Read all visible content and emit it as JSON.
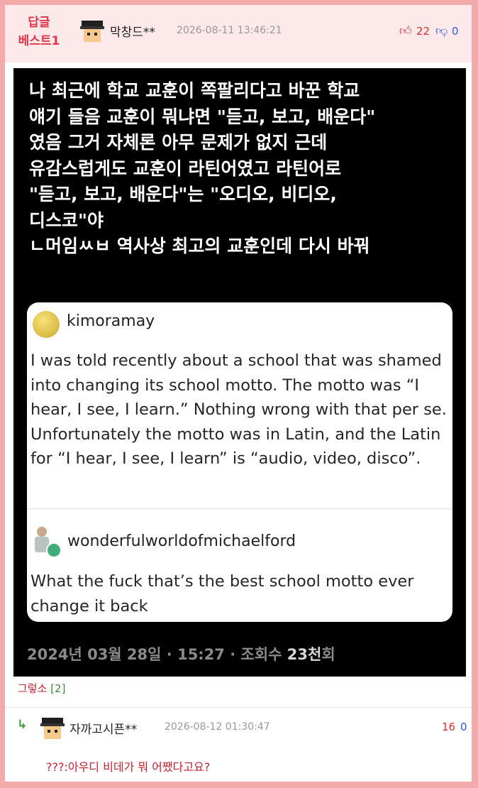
{
  "header": {
    "badge_line1": "답글",
    "badge_line2": "베스트1",
    "author": "막창드**",
    "date": "2026-08-11 13:46:21",
    "upvote_icon": "thumbs-up-icon",
    "upvotes": "22",
    "downvote_icon": "thumbs-down-icon",
    "downvotes": "0"
  },
  "post_image": {
    "caption": "나 최근에 학교 교훈이 쪽팔리다고 바꾼 학교\n얘기 들음 교훈이 뭐냐면 \"듣고, 보고, 배운다\"\n였음 그거 자체론 아무 문제가 없지 근데\n유감스럽게도 교훈이 라틴어였고 라틴어로\n\"듣고, 보고, 배운다\"는 \"오디오, 비디오,\n디스코\"야\nㄴ머임ㅆㅂ 역사상 최고의 교훈인데 다시 바꿔",
    "tumblr": {
      "user1": "kimoramay",
      "post1": "I was told recently about a school that was shamed into changing its school motto. The motto was “I hear, I see, I learn.” Nothing wrong with that per se. Unfortunately the motto was in Latin, and the Latin for “I hear, I see, I learn” is “audio, video, disco”.",
      "user2": "wonderfulworldofmichaelford",
      "post2": "What the fuck that’s the best school motto ever change it back"
    },
    "footer_date": "2024년 03월 28일 · 15:27 · 조회수 ",
    "footer_views": "23천",
    "footer_suffix": "회"
  },
  "comment_line": {
    "text": "그렇소 ",
    "count": "[2]"
  },
  "reply": {
    "arrow": "↳",
    "author": "자까고시픈**",
    "date": "2026-08-12 01:30:47",
    "upvotes": "16",
    "downvotes": "0",
    "text": "???:아우디 비데가 뭐 어쨌다고요?"
  },
  "colors": {
    "border": "#f4a9ab",
    "header_bg": "#fde9ea",
    "accent_red": "#e0384a",
    "down_blue": "#2b5cd8"
  }
}
